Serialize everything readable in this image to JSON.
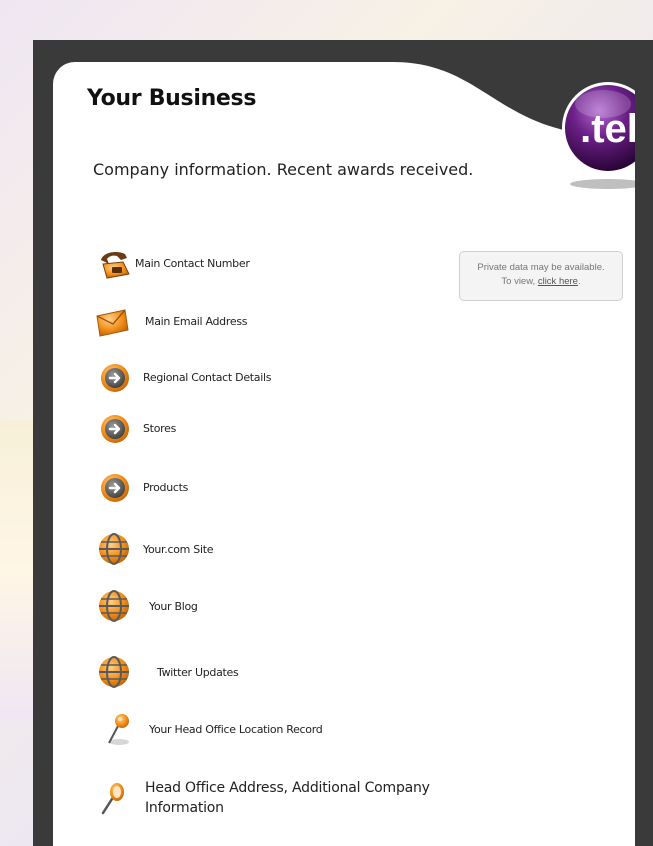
{
  "card": {
    "title": "Your Business",
    "subtitle": "Company information. Recent awards received."
  },
  "logo": {
    "text": ".tel"
  },
  "private_notice": {
    "line1": "Private data may be available.",
    "line2_prefix": "To view,",
    "link_text": "click here",
    "line2_suffix": "."
  },
  "items": [
    {
      "label": "Main Contact Number",
      "icon": "telephone-icon"
    },
    {
      "label": "Main Email Address",
      "icon": "envelope-icon"
    },
    {
      "label": "Regional Contact Details",
      "icon": "arrow-circle-icon"
    },
    {
      "label": "Stores",
      "icon": "arrow-circle-icon"
    },
    {
      "label": "Products",
      "icon": "arrow-circle-icon"
    },
    {
      "label": "Your.com Site",
      "icon": "globe-icon"
    },
    {
      "label": "Your Blog",
      "icon": "globe-icon"
    },
    {
      "label": "Twitter Updates",
      "icon": "globe-icon"
    },
    {
      "label": "Your Head Office Location Record",
      "icon": "map-pin-icon"
    },
    {
      "label": "Head Office Address, Additional Company Information",
      "icon": "magnifier-icon"
    }
  ],
  "colors": {
    "frame": "#3a3a3a",
    "accent_orange": "#f08a1c",
    "logo_purple": "#5a1a6e"
  }
}
